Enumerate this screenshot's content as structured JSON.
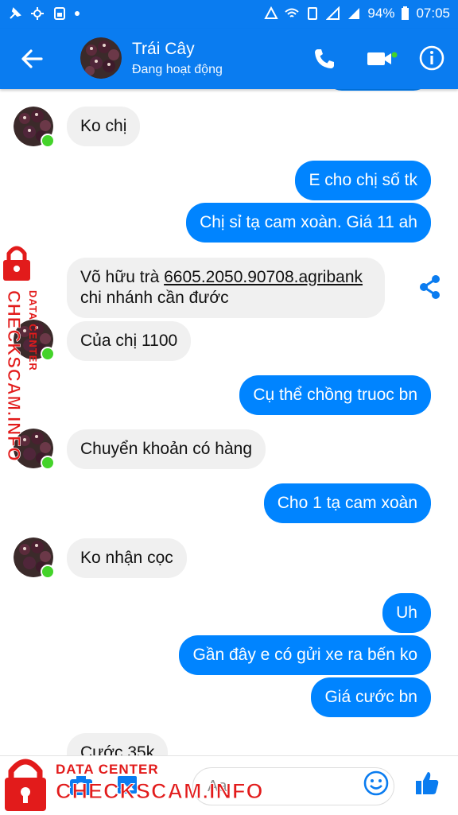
{
  "status_bar": {
    "battery": "94%",
    "time": "07:05"
  },
  "header": {
    "name": "Trái Cây",
    "status": "Đang hoạt động"
  },
  "messages": [
    {
      "side": "in",
      "text": "Ko chị"
    },
    {
      "side": "out",
      "text": "E cho chị số tk"
    },
    {
      "side": "out",
      "text": "Chị sỉ tạ cam xoàn. Giá 11 ah"
    },
    {
      "side": "in",
      "line1_prefix": "Võ hữu trà ",
      "line1_link": "6605.2050.90708.agribank",
      "line2": "chi nhánh cần đước"
    },
    {
      "side": "in",
      "text": "Của chị 1100"
    },
    {
      "side": "out",
      "text": "Cụ thể chồng truoc bn"
    },
    {
      "side": "in",
      "text": "Chuyển khoản có hàng"
    },
    {
      "side": "out",
      "text": "Cho 1 tạ cam xoàn"
    },
    {
      "side": "in",
      "text": "Ko nhận cọc"
    },
    {
      "side": "out",
      "text": "Uh"
    },
    {
      "side": "out",
      "text": "Gần đây e có gửi xe ra bến ko"
    },
    {
      "side": "out",
      "text": "Giá cước bn"
    },
    {
      "side": "in",
      "text": "Cước 35k"
    }
  ],
  "composer": {
    "placeholder": "Aa"
  },
  "watermark": {
    "line1": "DATA CENTER",
    "line2": "CHECKSCAM.INFO"
  },
  "icons": [
    "back-arrow-icon",
    "phone-icon",
    "video-camera-icon",
    "info-icon",
    "share-icon",
    "camera-icon",
    "image-icon",
    "emoji-icon",
    "thumbs-up-icon"
  ],
  "colors": {
    "brand_blue": "#0a7cf0",
    "outgoing_bubble": "#0084ff",
    "incoming_bubble": "#f0f0f0",
    "online_green": "#44d32a",
    "watermark_red": "#e21b1b"
  }
}
